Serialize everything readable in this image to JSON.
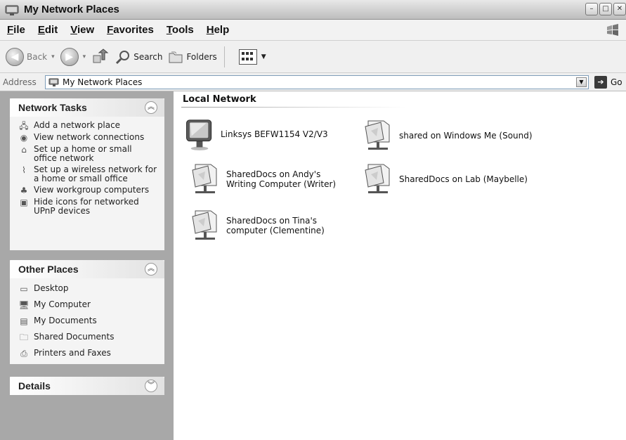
{
  "window": {
    "title": "My Network Places"
  },
  "menu": [
    "File",
    "Edit",
    "View",
    "Favorites",
    "Tools",
    "Help"
  ],
  "toolbar": {
    "back": "Back",
    "search": "Search",
    "folders": "Folders"
  },
  "address": {
    "label": "Address",
    "value": "My Network Places",
    "go": "Go"
  },
  "network_tasks": {
    "title": "Network Tasks",
    "items": [
      "Add a network place",
      "View network connections",
      "Set up a home or small office network",
      "Set up a wireless network for a home or small office",
      "View workgroup computers",
      "Hide icons for networked UPnP devices"
    ]
  },
  "other_places": {
    "title": "Other Places",
    "items": [
      "Desktop",
      "My Computer",
      "My Documents",
      "Shared Documents",
      "Printers and Faxes"
    ]
  },
  "details": {
    "title": "Details"
  },
  "content": {
    "group_title": "Local Network",
    "items": [
      "Linksys BEFW1154 V2/V3",
      "shared on Windows Me (Sound)",
      "SharedDocs on Andy's Writing Computer (Writer)",
      "SharedDocs on Lab (Maybelle)",
      "SharedDocs on Tina's computer (Clementine)"
    ]
  }
}
